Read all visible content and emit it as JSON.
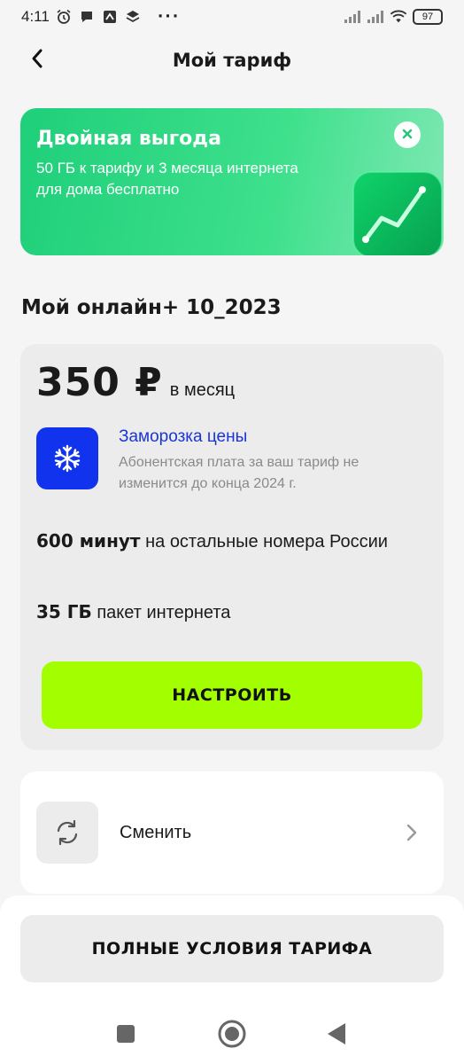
{
  "status_bar": {
    "time": "4:11",
    "more": "···",
    "battery": "97"
  },
  "header": {
    "title": "Мой тариф"
  },
  "promo": {
    "title": "Двойная выгода",
    "text": "50 ГБ к тарифу и 3 месяца интернета для дома бесплатно"
  },
  "plan": {
    "name": "Мой онлайн+ 10_2023",
    "price": "350 ₽",
    "price_period": "в месяц",
    "freeze_title": "Заморозка цены",
    "freeze_desc": "Абонентская плата за ваш тариф не изменится до конца 2024 г.",
    "feature_1_strong": "600 минут",
    "feature_1_text": " на остальные номера России",
    "feature_2_strong": "35 ГБ",
    "feature_2_text": " пакет интернета",
    "configure_label": "НАСТРОИТЬ"
  },
  "change": {
    "label": "Сменить"
  },
  "terms": {
    "label": "ПОЛНЫЕ УСЛОВИЯ ТАРИФА"
  },
  "colors": {
    "accent_green": "#a3ff00",
    "promo_green": "#1fcf7a",
    "freeze_blue": "#1133ee",
    "link_blue": "#1a35d6"
  },
  "icons": {
    "back": "chevron-left-icon",
    "close": "close-icon",
    "freeze": "snowflake-icon",
    "change": "refresh-icon",
    "chevron": "chevron-right-icon"
  }
}
